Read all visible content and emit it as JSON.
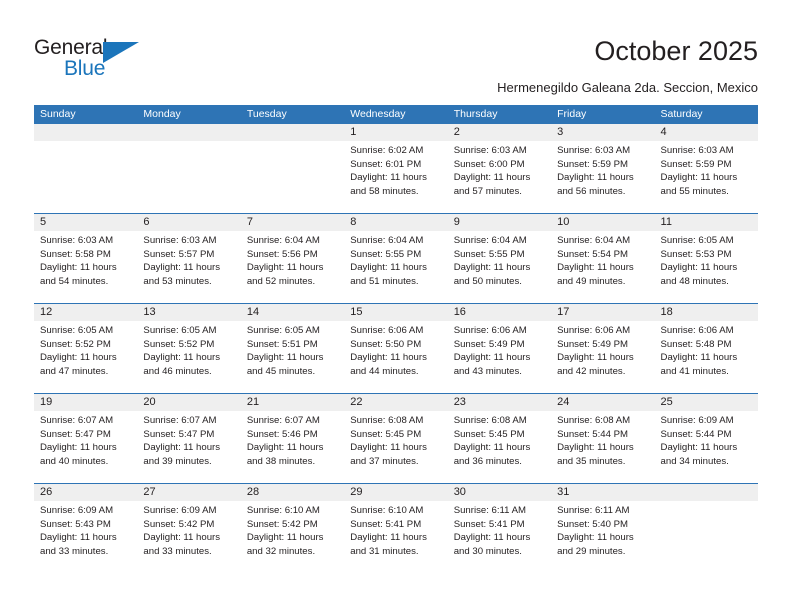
{
  "brand": {
    "name_part1": "General",
    "name_part2": "Blue"
  },
  "header": {
    "title": "October 2025",
    "subtitle": "Hermenegildo Galeana 2da. Seccion, Mexico"
  },
  "colors": {
    "header_blue": "#2e74b5",
    "brand_blue": "#1b75bb",
    "daynum_band": "#efefef",
    "text": "#231f20"
  },
  "weekdays": [
    "Sunday",
    "Monday",
    "Tuesday",
    "Wednesday",
    "Thursday",
    "Friday",
    "Saturday"
  ],
  "weeks": [
    [
      {
        "day": "",
        "sunrise": "",
        "sunset": "",
        "daylight_1": "",
        "daylight_2": ""
      },
      {
        "day": "",
        "sunrise": "",
        "sunset": "",
        "daylight_1": "",
        "daylight_2": ""
      },
      {
        "day": "",
        "sunrise": "",
        "sunset": "",
        "daylight_1": "",
        "daylight_2": ""
      },
      {
        "day": "1",
        "sunrise": "Sunrise: 6:02 AM",
        "sunset": "Sunset: 6:01 PM",
        "daylight_1": "Daylight: 11 hours",
        "daylight_2": "and 58 minutes."
      },
      {
        "day": "2",
        "sunrise": "Sunrise: 6:03 AM",
        "sunset": "Sunset: 6:00 PM",
        "daylight_1": "Daylight: 11 hours",
        "daylight_2": "and 57 minutes."
      },
      {
        "day": "3",
        "sunrise": "Sunrise: 6:03 AM",
        "sunset": "Sunset: 5:59 PM",
        "daylight_1": "Daylight: 11 hours",
        "daylight_2": "and 56 minutes."
      },
      {
        "day": "4",
        "sunrise": "Sunrise: 6:03 AM",
        "sunset": "Sunset: 5:59 PM",
        "daylight_1": "Daylight: 11 hours",
        "daylight_2": "and 55 minutes."
      }
    ],
    [
      {
        "day": "5",
        "sunrise": "Sunrise: 6:03 AM",
        "sunset": "Sunset: 5:58 PM",
        "daylight_1": "Daylight: 11 hours",
        "daylight_2": "and 54 minutes."
      },
      {
        "day": "6",
        "sunrise": "Sunrise: 6:03 AM",
        "sunset": "Sunset: 5:57 PM",
        "daylight_1": "Daylight: 11 hours",
        "daylight_2": "and 53 minutes."
      },
      {
        "day": "7",
        "sunrise": "Sunrise: 6:04 AM",
        "sunset": "Sunset: 5:56 PM",
        "daylight_1": "Daylight: 11 hours",
        "daylight_2": "and 52 minutes."
      },
      {
        "day": "8",
        "sunrise": "Sunrise: 6:04 AM",
        "sunset": "Sunset: 5:55 PM",
        "daylight_1": "Daylight: 11 hours",
        "daylight_2": "and 51 minutes."
      },
      {
        "day": "9",
        "sunrise": "Sunrise: 6:04 AM",
        "sunset": "Sunset: 5:55 PM",
        "daylight_1": "Daylight: 11 hours",
        "daylight_2": "and 50 minutes."
      },
      {
        "day": "10",
        "sunrise": "Sunrise: 6:04 AM",
        "sunset": "Sunset: 5:54 PM",
        "daylight_1": "Daylight: 11 hours",
        "daylight_2": "and 49 minutes."
      },
      {
        "day": "11",
        "sunrise": "Sunrise: 6:05 AM",
        "sunset": "Sunset: 5:53 PM",
        "daylight_1": "Daylight: 11 hours",
        "daylight_2": "and 48 minutes."
      }
    ],
    [
      {
        "day": "12",
        "sunrise": "Sunrise: 6:05 AM",
        "sunset": "Sunset: 5:52 PM",
        "daylight_1": "Daylight: 11 hours",
        "daylight_2": "and 47 minutes."
      },
      {
        "day": "13",
        "sunrise": "Sunrise: 6:05 AM",
        "sunset": "Sunset: 5:52 PM",
        "daylight_1": "Daylight: 11 hours",
        "daylight_2": "and 46 minutes."
      },
      {
        "day": "14",
        "sunrise": "Sunrise: 6:05 AM",
        "sunset": "Sunset: 5:51 PM",
        "daylight_1": "Daylight: 11 hours",
        "daylight_2": "and 45 minutes."
      },
      {
        "day": "15",
        "sunrise": "Sunrise: 6:06 AM",
        "sunset": "Sunset: 5:50 PM",
        "daylight_1": "Daylight: 11 hours",
        "daylight_2": "and 44 minutes."
      },
      {
        "day": "16",
        "sunrise": "Sunrise: 6:06 AM",
        "sunset": "Sunset: 5:49 PM",
        "daylight_1": "Daylight: 11 hours",
        "daylight_2": "and 43 minutes."
      },
      {
        "day": "17",
        "sunrise": "Sunrise: 6:06 AM",
        "sunset": "Sunset: 5:49 PM",
        "daylight_1": "Daylight: 11 hours",
        "daylight_2": "and 42 minutes."
      },
      {
        "day": "18",
        "sunrise": "Sunrise: 6:06 AM",
        "sunset": "Sunset: 5:48 PM",
        "daylight_1": "Daylight: 11 hours",
        "daylight_2": "and 41 minutes."
      }
    ],
    [
      {
        "day": "19",
        "sunrise": "Sunrise: 6:07 AM",
        "sunset": "Sunset: 5:47 PM",
        "daylight_1": "Daylight: 11 hours",
        "daylight_2": "and 40 minutes."
      },
      {
        "day": "20",
        "sunrise": "Sunrise: 6:07 AM",
        "sunset": "Sunset: 5:47 PM",
        "daylight_1": "Daylight: 11 hours",
        "daylight_2": "and 39 minutes."
      },
      {
        "day": "21",
        "sunrise": "Sunrise: 6:07 AM",
        "sunset": "Sunset: 5:46 PM",
        "daylight_1": "Daylight: 11 hours",
        "daylight_2": "and 38 minutes."
      },
      {
        "day": "22",
        "sunrise": "Sunrise: 6:08 AM",
        "sunset": "Sunset: 5:45 PM",
        "daylight_1": "Daylight: 11 hours",
        "daylight_2": "and 37 minutes."
      },
      {
        "day": "23",
        "sunrise": "Sunrise: 6:08 AM",
        "sunset": "Sunset: 5:45 PM",
        "daylight_1": "Daylight: 11 hours",
        "daylight_2": "and 36 minutes."
      },
      {
        "day": "24",
        "sunrise": "Sunrise: 6:08 AM",
        "sunset": "Sunset: 5:44 PM",
        "daylight_1": "Daylight: 11 hours",
        "daylight_2": "and 35 minutes."
      },
      {
        "day": "25",
        "sunrise": "Sunrise: 6:09 AM",
        "sunset": "Sunset: 5:44 PM",
        "daylight_1": "Daylight: 11 hours",
        "daylight_2": "and 34 minutes."
      }
    ],
    [
      {
        "day": "26",
        "sunrise": "Sunrise: 6:09 AM",
        "sunset": "Sunset: 5:43 PM",
        "daylight_1": "Daylight: 11 hours",
        "daylight_2": "and 33 minutes."
      },
      {
        "day": "27",
        "sunrise": "Sunrise: 6:09 AM",
        "sunset": "Sunset: 5:42 PM",
        "daylight_1": "Daylight: 11 hours",
        "daylight_2": "and 33 minutes."
      },
      {
        "day": "28",
        "sunrise": "Sunrise: 6:10 AM",
        "sunset": "Sunset: 5:42 PM",
        "daylight_1": "Daylight: 11 hours",
        "daylight_2": "and 32 minutes."
      },
      {
        "day": "29",
        "sunrise": "Sunrise: 6:10 AM",
        "sunset": "Sunset: 5:41 PM",
        "daylight_1": "Daylight: 11 hours",
        "daylight_2": "and 31 minutes."
      },
      {
        "day": "30",
        "sunrise": "Sunrise: 6:11 AM",
        "sunset": "Sunset: 5:41 PM",
        "daylight_1": "Daylight: 11 hours",
        "daylight_2": "and 30 minutes."
      },
      {
        "day": "31",
        "sunrise": "Sunrise: 6:11 AM",
        "sunset": "Sunset: 5:40 PM",
        "daylight_1": "Daylight: 11 hours",
        "daylight_2": "and 29 minutes."
      },
      {
        "day": "",
        "sunrise": "",
        "sunset": "",
        "daylight_1": "",
        "daylight_2": ""
      }
    ]
  ]
}
